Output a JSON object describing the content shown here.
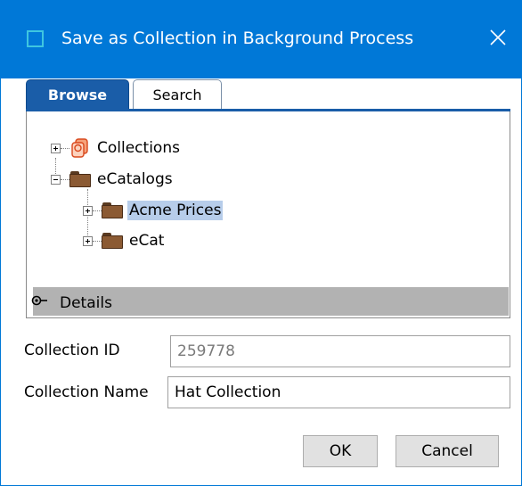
{
  "window": {
    "title": "Save as Collection in Background Process",
    "accent_color": "#0078d7"
  },
  "tabs": [
    {
      "label": "Browse",
      "active": true
    },
    {
      "label": "Search",
      "active": false
    }
  ],
  "tree": {
    "items": [
      {
        "label": "Collections",
        "icon": "collections-icon",
        "expander": "plus"
      },
      {
        "label": "eCatalogs",
        "icon": "folder-icon",
        "expander": "minus"
      },
      {
        "label": "Acme Prices",
        "icon": "folder-icon",
        "expander": "plus",
        "selected": true
      },
      {
        "label": "eCat",
        "icon": "folder-icon",
        "expander": "plus"
      }
    ]
  },
  "details": {
    "label": "Details"
  },
  "fields": {
    "collection_id": {
      "label": "Collection ID",
      "value": "259778"
    },
    "collection_name": {
      "label": "Collection Name",
      "value": "Hat Collection"
    }
  },
  "buttons": {
    "ok": "OK",
    "cancel": "Cancel"
  }
}
